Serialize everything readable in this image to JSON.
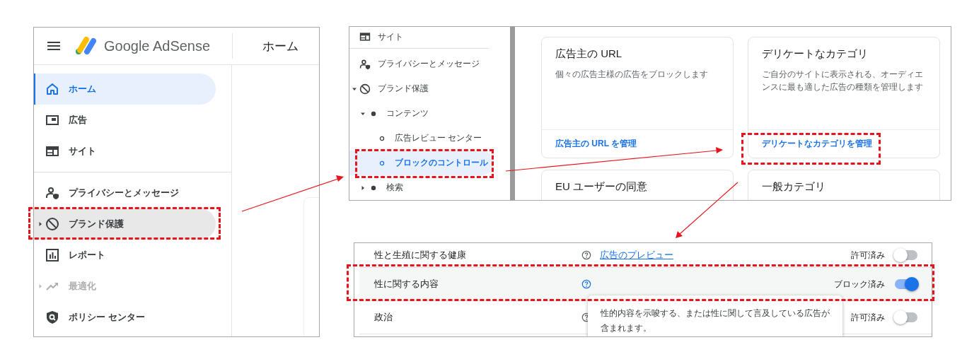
{
  "overview_panel": {
    "logo_text": "Google AdSense",
    "page_title": "ホーム",
    "nav_groups": [
      [
        {
          "label": "ホーム",
          "kind": "home",
          "selected": true,
          "hovered": false,
          "disabled": false,
          "has_children": false
        },
        {
          "label": "広告",
          "kind": "ads",
          "selected": false,
          "hovered": false,
          "disabled": false,
          "has_children": false
        },
        {
          "label": "サイト",
          "kind": "site",
          "selected": false,
          "hovered": false,
          "disabled": false,
          "has_children": false
        }
      ],
      [
        {
          "label": "プライバシーとメッセージ",
          "kind": "privacy",
          "selected": false,
          "hovered": false,
          "disabled": false,
          "has_children": false
        },
        {
          "label": "ブランド保護",
          "kind": "block",
          "selected": false,
          "hovered": true,
          "disabled": false,
          "has_children": true
        },
        {
          "label": "レポート",
          "kind": "report",
          "selected": false,
          "hovered": false,
          "disabled": false,
          "has_children": false
        },
        {
          "label": "最適化",
          "kind": "trend",
          "selected": false,
          "hovered": false,
          "disabled": true,
          "has_children": true
        },
        {
          "label": "ポリシー センター",
          "kind": "policy",
          "selected": false,
          "hovered": false,
          "disabled": false,
          "has_children": false
        }
      ]
    ]
  },
  "controls_panel": {
    "nav_groups": [
      [
        {
          "label": "サイト",
          "kind": "site",
          "selected": false
        }
      ],
      [
        {
          "label": "プライバシーとメッセージ",
          "kind": "privacy",
          "selected": false
        },
        {
          "label": "ブランド保護",
          "kind": "block",
          "selected": false,
          "expanded": true,
          "children": [
            {
              "label": "コンテンツ",
              "kind": "dot",
              "selected": false,
              "expanded": true,
              "children": [
                {
                  "label": "広告レビュー センター",
                  "kind": "ring",
                  "selected": false
                },
                {
                  "label": "ブロックのコントロール",
                  "kind": "ring",
                  "selected": true
                }
              ]
            },
            {
              "label": "検索",
              "kind": "dot",
              "selected": false,
              "expanded": false
            }
          ]
        }
      ]
    ],
    "cards": [
      {
        "title": "広告主の URL",
        "description": "個々の広告主様の広告をブロックします",
        "link": "広告主の URL を管理"
      },
      {
        "title": "デリケートなカテゴリ",
        "description": "ご自分のサイトに表示される、オーディエンスに最も適した広告の種類を管理します",
        "link": "デリケートなカテゴリを管理"
      },
      {
        "title": "EU ユーザーの同意"
      },
      {
        "title": "一般カテゴリ"
      }
    ]
  },
  "category_panel": {
    "rows": [
      {
        "label": "性と生殖に関する健康",
        "link": "広告のプレビュー",
        "status": "許可済み",
        "on": false,
        "hovered": false
      },
      {
        "label": "性に関する内容",
        "status": "ブロック済み",
        "on": true,
        "hovered": true
      },
      {
        "label": "政治",
        "status": "許可済み",
        "on": false,
        "hovered": false
      }
    ],
    "tooltip": "性的内容を示唆する、または性に関して言及している広告が含まれます。"
  }
}
